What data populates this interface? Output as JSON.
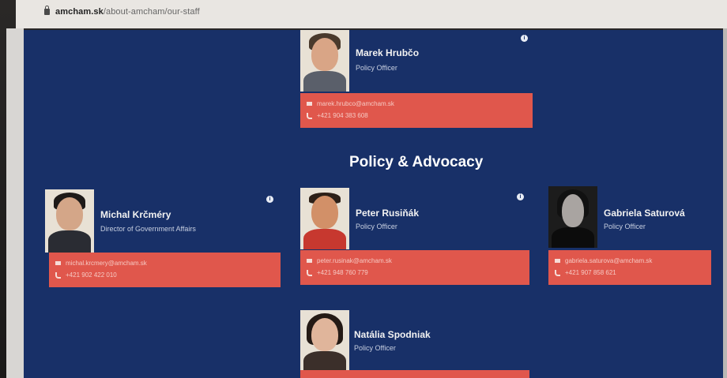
{
  "browser": {
    "url_host": "amcham.sk",
    "url_path": "/about-amcham/our-staff"
  },
  "section": {
    "title": "Policy & Advocacy"
  },
  "staff": [
    {
      "name": "Marek Hrubčo",
      "title": "Policy Officer",
      "email": "marek.hrubco@amcham.sk",
      "phone": "+421 904 383 608"
    },
    {
      "name": "Michal Krčméry",
      "title": "Director of Government Affairs",
      "email": "michal.krcmery@amcham.sk",
      "phone": "+421 902 422 010"
    },
    {
      "name": "Peter Rusiňák",
      "title": "Policy Officer",
      "email": "peter.rusinak@amcham.sk",
      "phone": "+421 948 760 779"
    },
    {
      "name": "Gabriela Saturová",
      "title": "Policy Officer",
      "email": "gabriela.saturova@amcham.sk",
      "phone": "+421 907 858 621"
    },
    {
      "name": "Natália Spodniak",
      "title": "Policy Officer"
    }
  ],
  "icons": {
    "info": "info-icon",
    "mail": "mail-icon",
    "phone": "phone-icon",
    "lock": "lock-icon"
  },
  "colors": {
    "page_background": "#183068",
    "contact_box": "#e0574c"
  }
}
